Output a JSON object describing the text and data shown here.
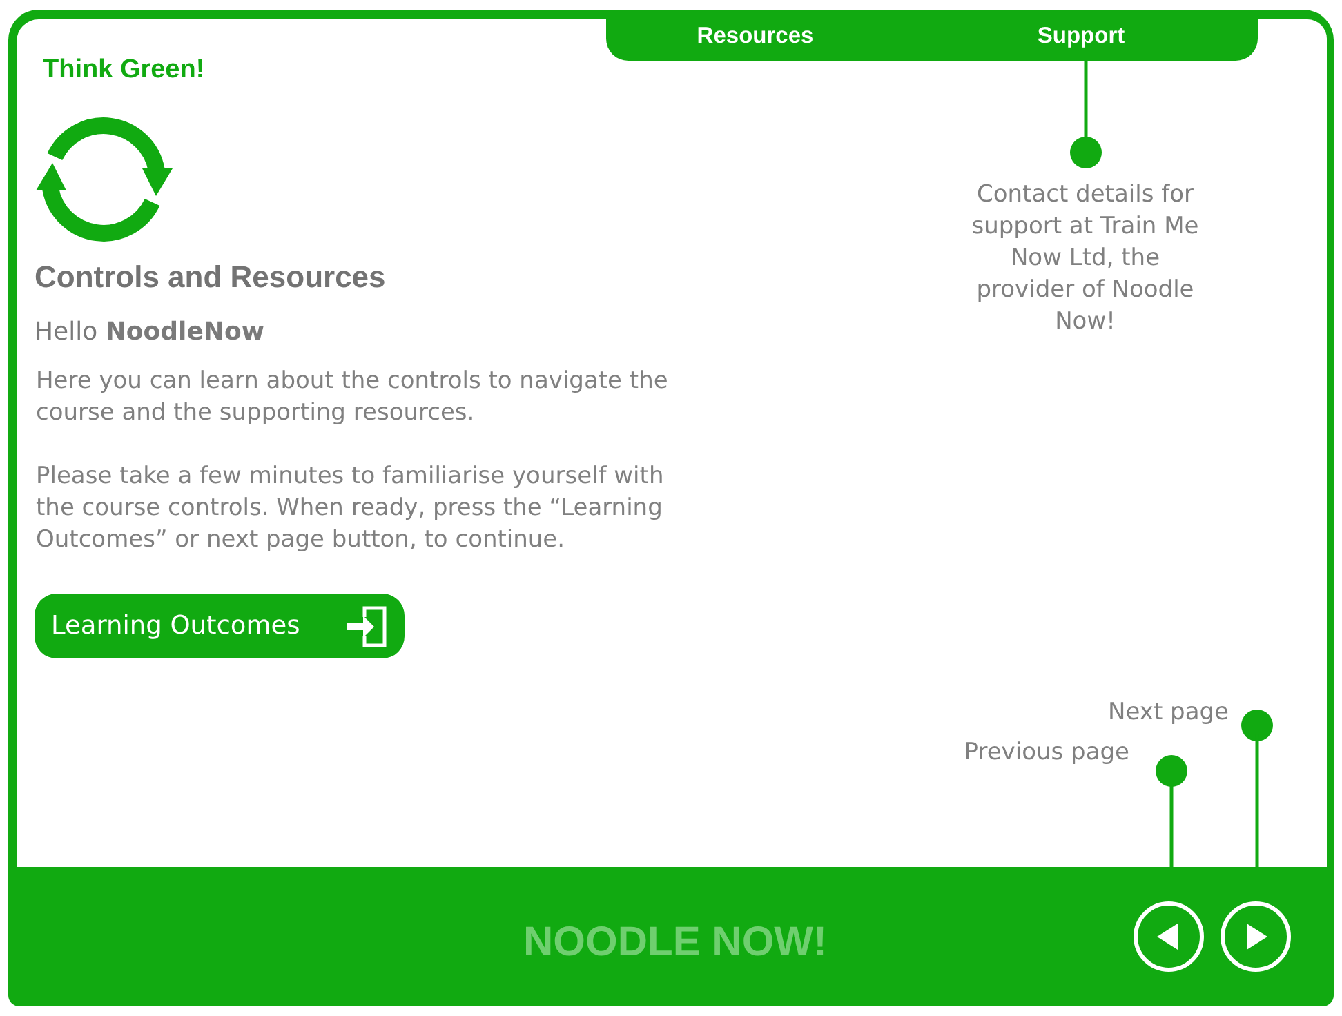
{
  "top_menu": [
    {
      "label": "Resources"
    },
    {
      "label": "Support"
    }
  ],
  "tagline": "Think Green!",
  "page": {
    "title": "Controls and Resources",
    "greeting": "Hello **NoodleNow**",
    "paragraphs": [
      "Here you can learn about the controls to navigate the course and the supporting resources.",
      "Please take a few minutes to familiarise yourself with the course controls. When ready, press the “Learning Outcomes” or next page button, to continue."
    ]
  },
  "primary_button": {
    "label": "Learning Outcomes"
  },
  "callouts": {
    "support": "Contact details for support at Train Me Now Ltd, the provider of Noodle Now!",
    "next_page": "Next page",
    "previous_page": "Previous page"
  },
  "footer": {
    "logo": "NOODLE NOW!"
  }
}
